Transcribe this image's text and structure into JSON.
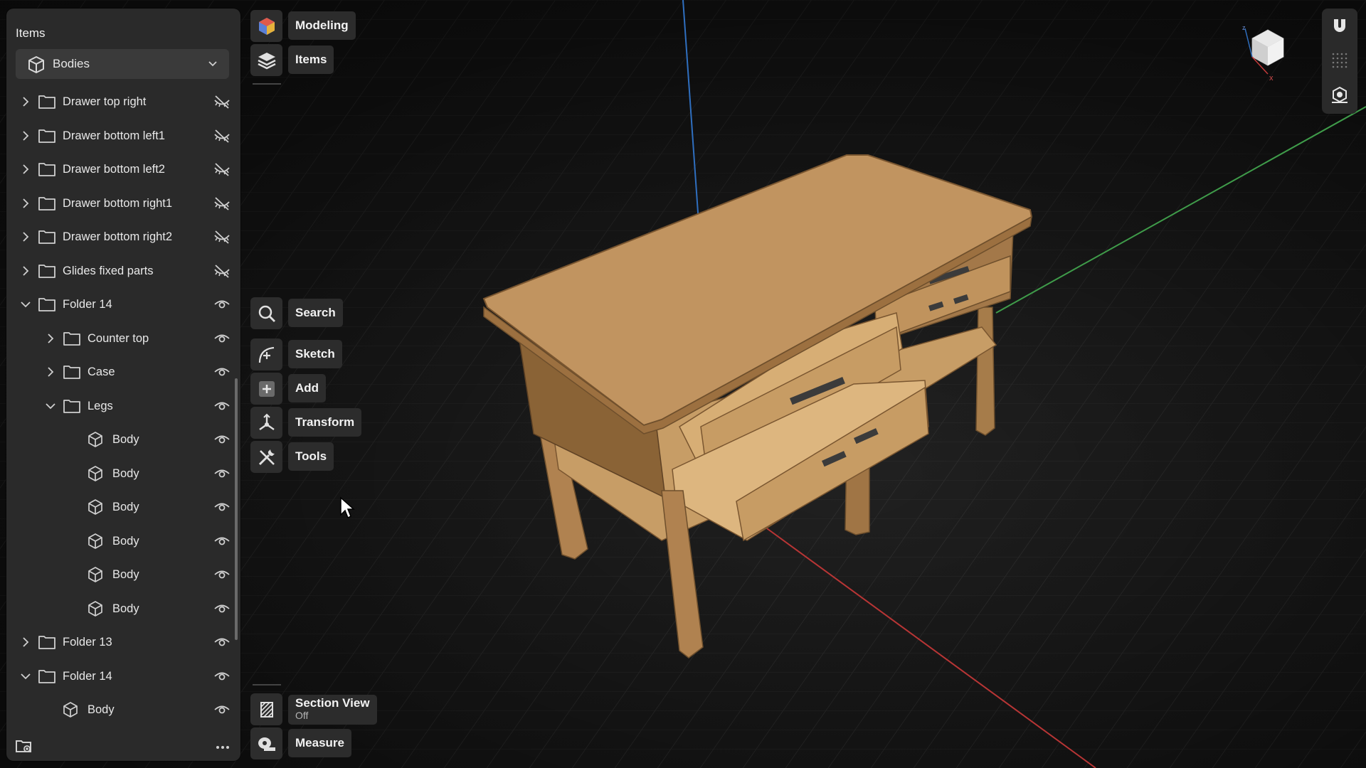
{
  "panel": {
    "title": "Items",
    "bodies_label": "Bodies",
    "tree": [
      {
        "label": "Drawer top right",
        "depth": 0,
        "expander": "collapsed",
        "icon": "folder-icon",
        "visible": false
      },
      {
        "label": "Drawer bottom left1",
        "depth": 0,
        "expander": "collapsed",
        "icon": "folder-icon",
        "visible": false
      },
      {
        "label": "Drawer bottom left2",
        "depth": 0,
        "expander": "collapsed",
        "icon": "folder-icon",
        "visible": false
      },
      {
        "label": "Drawer bottom right1",
        "depth": 0,
        "expander": "collapsed",
        "icon": "folder-icon",
        "visible": false
      },
      {
        "label": "Drawer bottom right2",
        "depth": 0,
        "expander": "collapsed",
        "icon": "folder-icon",
        "visible": false
      },
      {
        "label": "Glides fixed parts",
        "depth": 0,
        "expander": "collapsed",
        "icon": "folder-icon",
        "visible": false
      },
      {
        "label": "Folder 14",
        "depth": 0,
        "expander": "expanded",
        "icon": "folder-icon",
        "visible": true
      },
      {
        "label": "Counter top",
        "depth": 1,
        "expander": "collapsed",
        "icon": "folder-icon",
        "visible": true
      },
      {
        "label": "Case",
        "depth": 1,
        "expander": "collapsed",
        "icon": "folder-icon",
        "visible": true
      },
      {
        "label": "Legs",
        "depth": 1,
        "expander": "expanded",
        "icon": "folder-icon",
        "visible": true
      },
      {
        "label": "Body",
        "depth": 2,
        "expander": "none",
        "icon": "body-cube-icon",
        "visible": true
      },
      {
        "label": "Body",
        "depth": 2,
        "expander": "none",
        "icon": "body-cube-icon",
        "visible": true
      },
      {
        "label": "Body",
        "depth": 2,
        "expander": "none",
        "icon": "body-cube-icon",
        "visible": true
      },
      {
        "label": "Body",
        "depth": 2,
        "expander": "none",
        "icon": "body-cube-icon",
        "visible": true
      },
      {
        "label": "Body",
        "depth": 2,
        "expander": "none",
        "icon": "body-cube-icon",
        "visible": true
      },
      {
        "label": "Body",
        "depth": 2,
        "expander": "none",
        "icon": "body-cube-icon",
        "visible": true
      },
      {
        "label": "Folder 13",
        "depth": 0,
        "expander": "collapsed",
        "icon": "folder-icon",
        "visible": true
      },
      {
        "label": "Folder 14",
        "depth": 0,
        "expander": "expanded",
        "icon": "folder-icon",
        "visible": true
      },
      {
        "label": "Body",
        "depth": 1,
        "expander": "none",
        "icon": "body-cube-icon",
        "visible": true
      }
    ]
  },
  "top_toolbar": {
    "modeling": "Modeling",
    "items": "Items"
  },
  "tools": {
    "search": "Search",
    "sketch": "Sketch",
    "add": "Add",
    "transform": "Transform",
    "tools": "Tools"
  },
  "bottom_tools": {
    "section_view": "Section View",
    "section_view_state": "Off",
    "measure": "Measure"
  },
  "axis_cube": {
    "z": "z",
    "x": "x"
  },
  "colors": {
    "wood": "#b98d5a",
    "axis_x": "#c23a3a",
    "axis_y": "#3f9c4a",
    "axis_z": "#2f6fc0"
  }
}
